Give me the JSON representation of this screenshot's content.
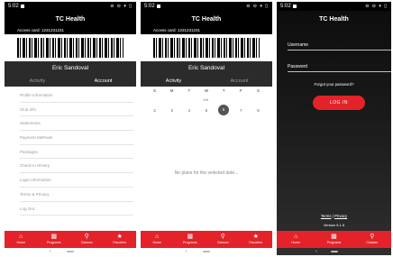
{
  "app": {
    "title": "TC Health"
  },
  "status": {
    "time": "5:02",
    "icons": "⊖ ⊝ ▾ ▯"
  },
  "member": {
    "access_card_label": "Access card: 1231231231",
    "name": "Eric Sandoval"
  },
  "tabs": [
    "Activity",
    "Account"
  ],
  "account_menu": [
    "Profile Information",
    "Club Info",
    "Statements",
    "Payment Methods",
    "Packages",
    "Check-in History",
    "Login Information",
    "Terms & Privacy",
    "Log Out"
  ],
  "calendar": {
    "weekdays": [
      "S",
      "M",
      "T",
      "W",
      "T",
      "F",
      "S"
    ],
    "month": "JAN",
    "days": [
      "2",
      "3",
      "4",
      "5",
      "6",
      "7",
      "8"
    ],
    "selected_day": "6",
    "empty_message": "No plans for the selected date..."
  },
  "nav": [
    {
      "label": "Home",
      "icon": "home-icon",
      "glyph": "⌂"
    },
    {
      "label": "Programs",
      "icon": "calendar-icon",
      "glyph": "▦"
    },
    {
      "label": "Classes",
      "icon": "running-person-icon",
      "glyph": "⚲"
    },
    {
      "label": "Favorites",
      "icon": "star-icon",
      "glyph": "★"
    }
  ],
  "login": {
    "username_label": "Username",
    "password_label": "Password",
    "forgot": "Forgot your password?",
    "button": "LOG IN",
    "terms": "Terms",
    "separator": "|",
    "privacy": "Privacy",
    "version": "Version 6.1.8"
  },
  "colors": {
    "accent": "#e32229",
    "header": "#000000",
    "profile_band": "#2b2b2b"
  }
}
